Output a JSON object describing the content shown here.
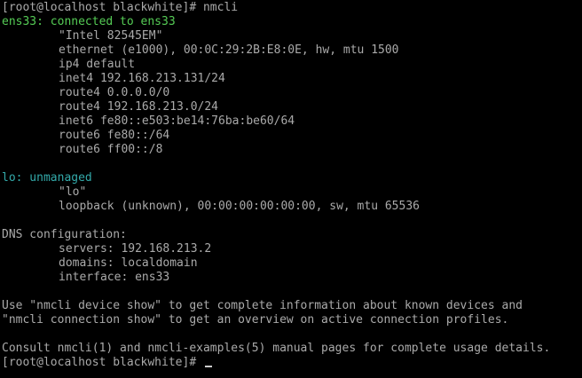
{
  "terminal": {
    "command_prompt": "[root@localhost blackwhite]# nmcli",
    "devices": [
      {
        "header": "ens33: connected to ens33",
        "details": [
          "\"Intel 82545EM\"",
          "ethernet (e1000), 00:0C:29:2B:E8:0E, hw, mtu 1500",
          "ip4 default",
          "inet4 192.168.213.131/24",
          "route4 0.0.0.0/0",
          "route4 192.168.213.0/24",
          "inet6 fe80::e503:be14:76ba:be60/64",
          "route6 fe80::/64",
          "route6 ff00::/8"
        ]
      },
      {
        "header": "lo: unmanaged",
        "details": [
          "\"lo\"",
          "loopback (unknown), 00:00:00:00:00:00, sw, mtu 65536"
        ]
      }
    ],
    "dns": {
      "header": "DNS configuration:",
      "details": [
        "servers: 192.168.213.2",
        "domains: localdomain",
        "interface: ens33"
      ]
    },
    "hints": [
      "Use \"nmcli device show\" to get complete information about known devices and",
      "\"nmcli connection show\" to get an overview on active connection profiles."
    ],
    "consult": "Consult nmcli(1) and nmcli-examples(5) manual pages for complete usage details.",
    "final_prompt": "[root@localhost blackwhite]# "
  },
  "colors": {
    "background": "#000000",
    "text": "#aaaaaa",
    "connected": "#55cc55",
    "unmanaged": "#33aaaa"
  }
}
